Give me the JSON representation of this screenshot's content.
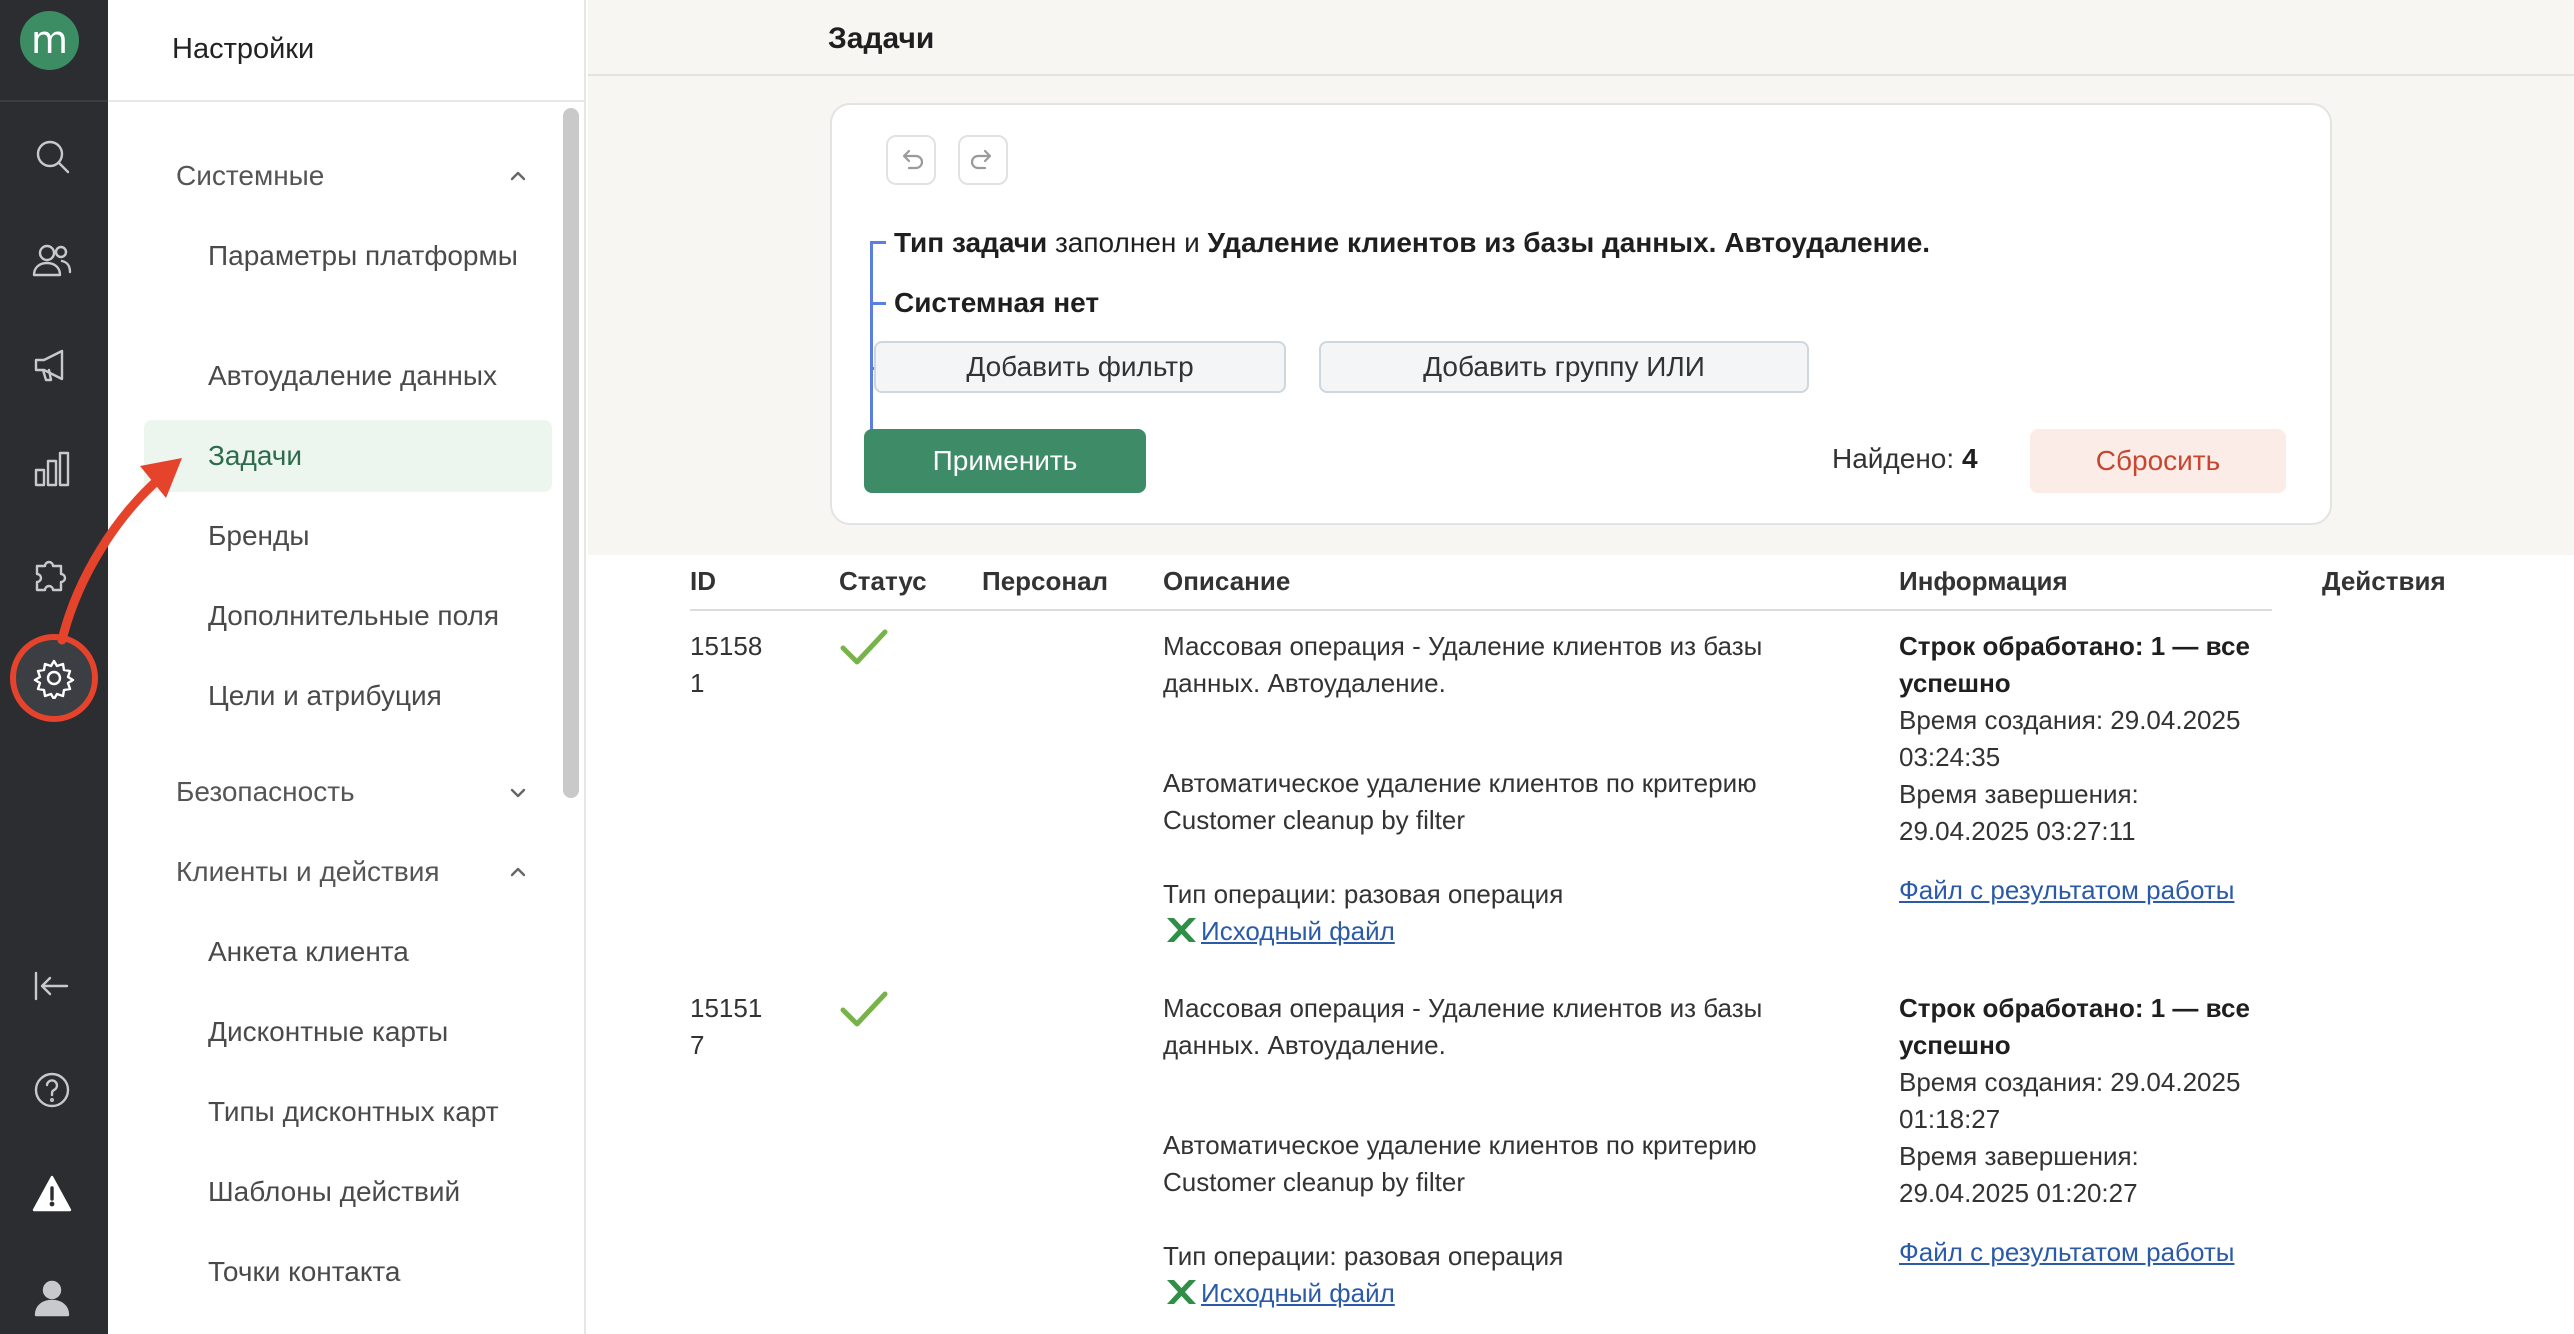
{
  "app": {
    "logo_letter": "m"
  },
  "rail": {
    "icons": [
      "search-icon",
      "users-icon",
      "megaphone-icon",
      "chart-icon",
      "puzzle-icon",
      "gear-icon",
      "collapse-icon",
      "help-icon",
      "warning-icon",
      "user-icon"
    ],
    "active": "gear-icon"
  },
  "sidebar": {
    "title": "Настройки",
    "groups": [
      {
        "label": "Системные",
        "expanded": true,
        "items": [
          "Параметры платформы",
          "Автоудаление данных",
          "Задачи",
          "Бренды",
          "Дополнительные поля",
          "Цели и атрибуция"
        ]
      },
      {
        "label": "Безопасность",
        "expanded": false,
        "items": []
      },
      {
        "label": "Клиенты и действия",
        "expanded": true,
        "items": [
          "Анкета клиента",
          "Дисконтные карты",
          "Типы дисконтных карт",
          "Шаблоны действий",
          "Точки контакта"
        ]
      }
    ],
    "active_item": "Задачи"
  },
  "main": {
    "title": "Задачи",
    "filter": {
      "cond1_bold1": "Тип задачи",
      "cond1_mid": " заполнен и ",
      "cond1_bold2": "Удаление клиентов из базы данных. Автоудаление.",
      "cond2": "Системная нет",
      "add_filter": "Добавить фильтр",
      "add_or_group": "Добавить группу ИЛИ",
      "apply": "Применить",
      "found_label": "Найдено:",
      "found_count": "4",
      "reset": "Сбросить"
    },
    "table": {
      "headers": {
        "id": "ID",
        "status": "Статус",
        "staff": "Персонал",
        "description": "Описание",
        "info": "Информация",
        "actions": "Действия"
      },
      "rows": [
        {
          "id_line1": "15158",
          "id_line2": "1",
          "desc_l1": "Массовая операция - Удаление клиентов из базы",
          "desc_l2": "данных. Автоудаление.",
          "desc_l3": "Автоматическое удаление клиентов по критерию",
          "desc_l4": "Customer cleanup by filter",
          "desc_l5": "Тип операции: разовая операция",
          "source_file": "Исходный файл",
          "info_l1": "Строк обработано: 1 — все",
          "info_l2": "успешно",
          "info_l3": "Время создания: 29.04.2025",
          "info_l4": "03:24:35",
          "info_l5": "Время завершения:",
          "info_l6": "29.04.2025 03:27:11",
          "result_file": "Файл с результатом работы"
        },
        {
          "id_line1": "15151",
          "id_line2": "7",
          "desc_l1": "Массовая операция - Удаление клиентов из базы",
          "desc_l2": "данных. Автоудаление.",
          "desc_l3": "Автоматическое удаление клиентов по критерию",
          "desc_l4": "Customer cleanup by filter",
          "desc_l5": "Тип операции: разовая операция",
          "source_file": "Исходный файл",
          "info_l1": "Строк обработано: 1 — все",
          "info_l2": "успешно",
          "info_l3": "Время создания: 29.04.2025",
          "info_l4": "01:18:27",
          "info_l5": "Время завершения:",
          "info_l6": "29.04.2025 01:20:27",
          "result_file": "Файл с результатом работы"
        }
      ]
    }
  },
  "colors": {
    "accent": "#3e8c67",
    "annotation": "#e5432b",
    "rail": "#2b2d30",
    "link": "#2b5aa8"
  }
}
